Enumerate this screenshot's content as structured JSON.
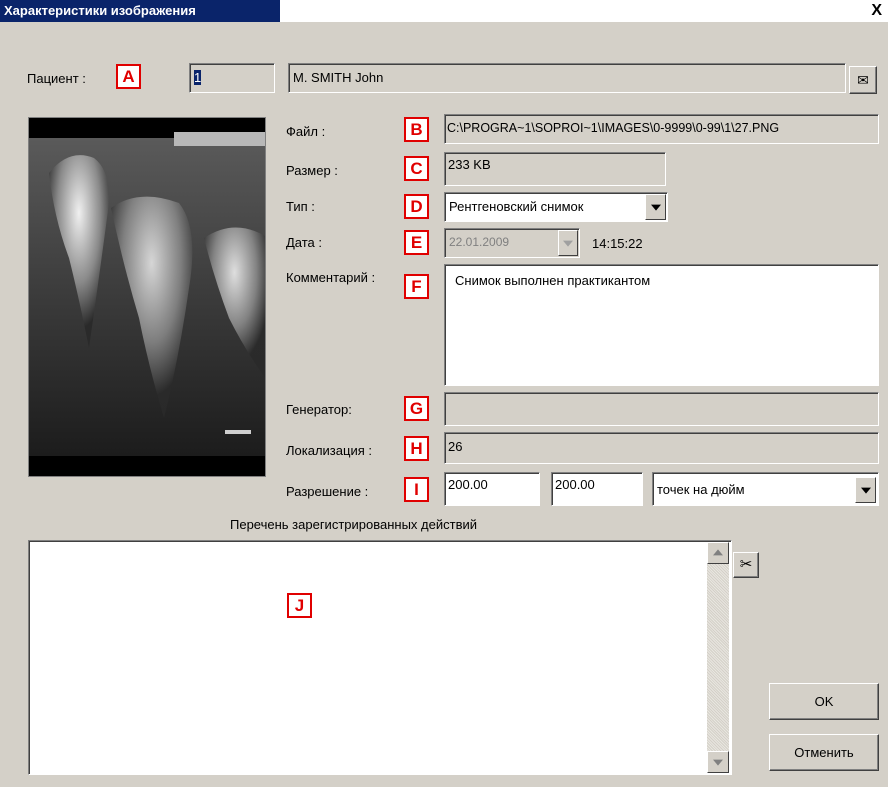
{
  "window": {
    "title": "Характеристики изображения",
    "close_glyph": "X"
  },
  "patient": {
    "label": "Пациент :",
    "marker": "A",
    "id": "1",
    "name": "M. SMITH John",
    "mail_glyph": "✉"
  },
  "file": {
    "label": "Файл :",
    "marker": "B",
    "value": "C:\\PROGRA~1\\SOPROI~1\\IMAGES\\0-9999\\0-99\\1\\27.PNG"
  },
  "size": {
    "label": "Размер :",
    "marker": "C",
    "value": "233 KB"
  },
  "type": {
    "label": "Тип :",
    "marker": "D",
    "value": "Рентгеновский снимок"
  },
  "date": {
    "label": "Дата :",
    "marker": "E",
    "value": "22.01.2009",
    "time": "14:15:22"
  },
  "comment": {
    "label": "Комментарий :",
    "marker": "F",
    "value": "Снимок выполнен практикантом"
  },
  "generator": {
    "label": "Генератор:",
    "marker": "G",
    "value": ""
  },
  "localization": {
    "label": "Локализация :",
    "marker": "H",
    "value": "26"
  },
  "resolution": {
    "label": "Разрешение :",
    "marker": "I",
    "x": "200.00",
    "y": "200.00",
    "unit": "точек на дюйм"
  },
  "actions": {
    "label": "Перечень зарегистрированных действий",
    "marker": "J",
    "cut_glyph": "✂"
  },
  "buttons": {
    "ok": "OK",
    "cancel": "Отменить"
  },
  "colors": {
    "title_bg": "#0a246a",
    "dialog_bg": "#d4d0c8",
    "marker": "#e00000"
  }
}
